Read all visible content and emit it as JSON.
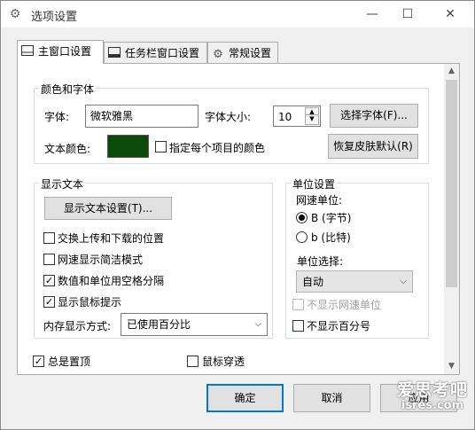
{
  "window": {
    "title": "选项设置",
    "icon": "gear-icon",
    "controls": [
      "minimize-icon",
      "maximize-icon",
      "close-icon"
    ]
  },
  "tabs": [
    {
      "label": "主窗口设置",
      "icon": "window-icon",
      "active": true
    },
    {
      "label": "任务栏窗口设置",
      "icon": "taskbar-icon",
      "active": false
    },
    {
      "label": "常规设置",
      "icon": "gear-icon",
      "active": false
    }
  ],
  "color_font": {
    "title": "颜色和字体",
    "font_label": "字体:",
    "font_value": "微软雅黑",
    "size_label": "字体大小:",
    "size_value": "10",
    "choose_font_button": "选择字体(F)...",
    "text_color_label": "文本颜色:",
    "text_color": "#0b4a0b",
    "per_item_color_label": "指定每个项目的颜色",
    "per_item_color_checked": false,
    "restore_skin_button": "恢复皮肤默认(R)"
  },
  "display_text": {
    "title": "显示文本",
    "settings_button": "显示文本设置(T)...",
    "options": [
      {
        "label": "交换上传和下载的位置",
        "checked": false
      },
      {
        "label": "网速显示简洁模式",
        "checked": false
      },
      {
        "label": "数值和单位用空格分隔",
        "checked": true
      },
      {
        "label": "显示鼠标提示",
        "checked": true
      }
    ],
    "memory_label": "内存显示方式:",
    "memory_value": "已使用百分比"
  },
  "unit": {
    "title": "单位设置",
    "speed_unit_label": "网速单位:",
    "radios": [
      {
        "label": "B (字节)",
        "selected": true
      },
      {
        "label": "b (比特)",
        "selected": false
      }
    ],
    "select_label": "单位选择:",
    "select_value": "自动",
    "hide_speed_unit_label": "不显示网速单位",
    "hide_speed_unit_checked": false,
    "hide_speed_unit_disabled": true,
    "hide_percent_label": "不显示百分号",
    "hide_percent_checked": false
  },
  "misc": {
    "always_on_top_label": "总是置顶",
    "always_on_top_checked": true,
    "mouse_through_label": "鼠标穿透",
    "mouse_through_checked": false
  },
  "footer": {
    "ok": "确定",
    "cancel": "取消",
    "apply": "应用"
  },
  "watermark": {
    "line1": "爱思考吧",
    "line2": "isres.com"
  }
}
